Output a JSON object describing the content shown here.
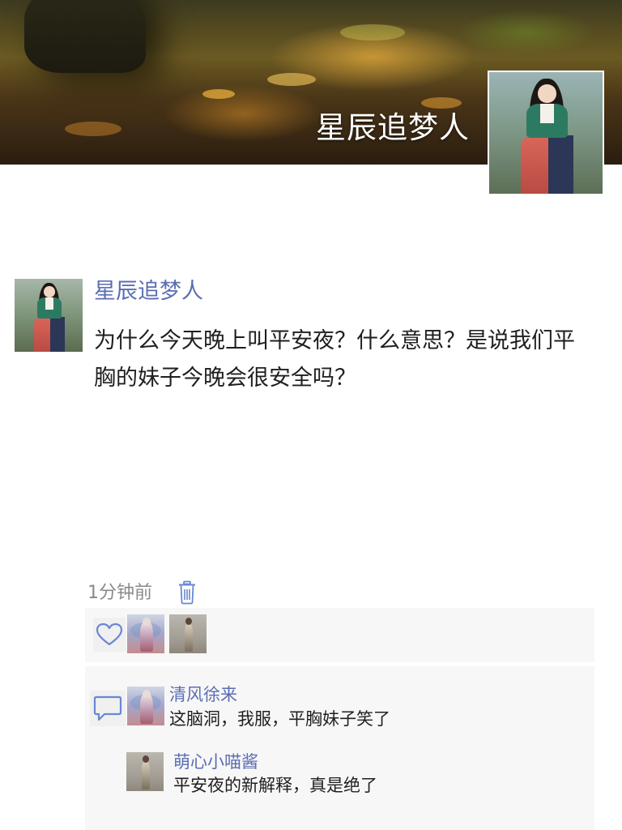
{
  "header": {
    "title": "星辰追梦人",
    "cover_image": "forest-autumn-cover",
    "avatar_image": "hanbok-woman-portrait"
  },
  "post": {
    "author": "星辰追梦人",
    "content": "为什么今天晚上叫平安夜？什么意思？是说我们平胸的妹子今晚会很安全吗？",
    "time": "1分钟前",
    "delete_icon": "trash-icon"
  },
  "likes": {
    "icon": "heart-icon",
    "users": [
      {
        "avatar": "angel-figure-avatar"
      },
      {
        "avatar": "standing-person-avatar"
      }
    ]
  },
  "comments": {
    "icon": "comment-bubble-icon",
    "items": [
      {
        "name": "清风徐来",
        "text": "这脑洞，我服，平胸妹子笑了",
        "avatar": "angel-figure-avatar"
      },
      {
        "name": "萌心小喵酱",
        "text": "平安夜的新解释，真是绝了",
        "avatar": "standing-person-avatar"
      }
    ]
  },
  "colors": {
    "link": "#5b6eb3",
    "text": "#1f1f1f",
    "meta": "#8a8a8a",
    "panel": "#f7f7f7"
  }
}
